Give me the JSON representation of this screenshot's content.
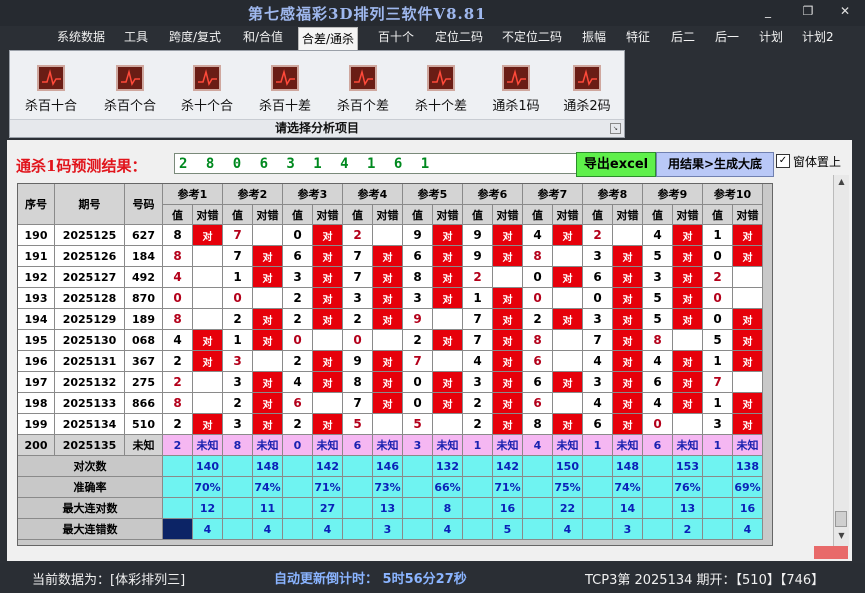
{
  "title": "第七感福彩3D排列三软件V8.81",
  "window_controls": [
    "_",
    "❐",
    "✕"
  ],
  "menu": [
    "系统数据",
    "工具",
    "跨度/复式",
    "和/合值",
    "合差/通杀",
    "百十个",
    "定位二码",
    "不定位二码",
    "振幅",
    "特征",
    "后二",
    "后一",
    "计划",
    "计划2"
  ],
  "active_menu": "合差/通杀",
  "ribbon": {
    "buttons": [
      "杀百十合",
      "杀百个合",
      "杀十个合",
      "杀百十差",
      "杀百个差",
      "杀十个差",
      "通杀1码",
      "通杀2码"
    ],
    "caption": "请选择分析项目"
  },
  "prediction": {
    "label": "通杀1码预测结果：",
    "value": "2 8 0 6 3 1 4 1 6 1"
  },
  "buttons": {
    "excel": "导出excel",
    "generate": "用结果>生成大底"
  },
  "checkbox": {
    "label": "窗体置上",
    "checked": true,
    "mark": "✓"
  },
  "table": {
    "col_seq": "序号",
    "col_issue": "期号",
    "col_code": "号码",
    "groups": [
      "参考1",
      "参考2",
      "参考3",
      "参考4",
      "参考5",
      "参考6",
      "参考7",
      "参考8",
      "参考9",
      "参考10"
    ],
    "sub": [
      "值",
      "对错"
    ],
    "hit_text": "对",
    "unknown_text": "未知",
    "rows": [
      {
        "seq": "190",
        "issue": "2025125",
        "code": "627",
        "refs": [
          [
            "8",
            1
          ],
          [
            "7",
            0
          ],
          [
            "0",
            1
          ],
          [
            "2",
            0
          ],
          [
            "9",
            1
          ],
          [
            "9",
            1
          ],
          [
            "4",
            1
          ],
          [
            "2",
            0
          ],
          [
            "4",
            1
          ],
          [
            "1",
            1
          ]
        ]
      },
      {
        "seq": "191",
        "issue": "2025126",
        "code": "184",
        "refs": [
          [
            "8",
            0
          ],
          [
            "7",
            1
          ],
          [
            "6",
            1
          ],
          [
            "7",
            1
          ],
          [
            "6",
            1
          ],
          [
            "9",
            1
          ],
          [
            "8",
            0
          ],
          [
            "3",
            1
          ],
          [
            "5",
            1
          ],
          [
            "0",
            1
          ]
        ]
      },
      {
        "seq": "192",
        "issue": "2025127",
        "code": "492",
        "refs": [
          [
            "4",
            0
          ],
          [
            "1",
            1
          ],
          [
            "3",
            1
          ],
          [
            "7",
            1
          ],
          [
            "8",
            1
          ],
          [
            "2",
            0
          ],
          [
            "0",
            1
          ],
          [
            "6",
            1
          ],
          [
            "3",
            1
          ],
          [
            "2",
            0
          ]
        ]
      },
      {
        "seq": "193",
        "issue": "2025128",
        "code": "870",
        "refs": [
          [
            "0",
            0
          ],
          [
            "0",
            0
          ],
          [
            "2",
            1
          ],
          [
            "3",
            1
          ],
          [
            "3",
            1
          ],
          [
            "1",
            1
          ],
          [
            "0",
            0
          ],
          [
            "0",
            1
          ],
          [
            "5",
            1
          ],
          [
            "0",
            0
          ]
        ]
      },
      {
        "seq": "194",
        "issue": "2025129",
        "code": "189",
        "refs": [
          [
            "8",
            0
          ],
          [
            "2",
            1
          ],
          [
            "2",
            1
          ],
          [
            "2",
            1
          ],
          [
            "9",
            0
          ],
          [
            "7",
            1
          ],
          [
            "2",
            1
          ],
          [
            "3",
            1
          ],
          [
            "5",
            1
          ],
          [
            "0",
            1
          ]
        ]
      },
      {
        "seq": "195",
        "issue": "2025130",
        "code": "068",
        "refs": [
          [
            "4",
            1
          ],
          [
            "1",
            1
          ],
          [
            "0",
            0
          ],
          [
            "0",
            0
          ],
          [
            "2",
            1
          ],
          [
            "7",
            1
          ],
          [
            "8",
            0
          ],
          [
            "7",
            1
          ],
          [
            "8",
            0
          ],
          [
            "5",
            1
          ]
        ]
      },
      {
        "seq": "196",
        "issue": "2025131",
        "code": "367",
        "refs": [
          [
            "2",
            1
          ],
          [
            "3",
            0
          ],
          [
            "2",
            1
          ],
          [
            "9",
            1
          ],
          [
            "7",
            0
          ],
          [
            "4",
            1
          ],
          [
            "6",
            0
          ],
          [
            "4",
            1
          ],
          [
            "4",
            1
          ],
          [
            "1",
            1
          ]
        ]
      },
      {
        "seq": "197",
        "issue": "2025132",
        "code": "275",
        "refs": [
          [
            "2",
            0
          ],
          [
            "3",
            1
          ],
          [
            "4",
            1
          ],
          [
            "8",
            1
          ],
          [
            "0",
            1
          ],
          [
            "3",
            1
          ],
          [
            "6",
            1
          ],
          [
            "3",
            1
          ],
          [
            "6",
            1
          ],
          [
            "7",
            0
          ]
        ]
      },
      {
        "seq": "198",
        "issue": "2025133",
        "code": "866",
        "refs": [
          [
            "8",
            0
          ],
          [
            "2",
            1
          ],
          [
            "6",
            0
          ],
          [
            "7",
            1
          ],
          [
            "0",
            1
          ],
          [
            "2",
            1
          ],
          [
            "6",
            0
          ],
          [
            "4",
            1
          ],
          [
            "4",
            1
          ],
          [
            "1",
            1
          ]
        ]
      },
      {
        "seq": "199",
        "issue": "2025134",
        "code": "510",
        "refs": [
          [
            "2",
            1
          ],
          [
            "3",
            1
          ],
          [
            "2",
            1
          ],
          [
            "5",
            0
          ],
          [
            "5",
            0
          ],
          [
            "2",
            1
          ],
          [
            "8",
            1
          ],
          [
            "6",
            1
          ],
          [
            "0",
            0
          ],
          [
            "3",
            1
          ]
        ]
      },
      {
        "seq": "200",
        "issue": "2025135",
        "code": "未知",
        "unknown": true,
        "refs": [
          [
            "2",
            0
          ],
          [
            "8",
            0
          ],
          [
            "0",
            0
          ],
          [
            "6",
            0
          ],
          [
            "3",
            0
          ],
          [
            "1",
            0
          ],
          [
            "4",
            0
          ],
          [
            "1",
            0
          ],
          [
            "6",
            0
          ],
          [
            "1",
            0
          ]
        ]
      }
    ],
    "stats": [
      {
        "label": "对次数",
        "values": [
          "140",
          "148",
          "142",
          "146",
          "132",
          "142",
          "150",
          "148",
          "153",
          "138"
        ]
      },
      {
        "label": "准确率",
        "values": [
          "70%",
          "74%",
          "71%",
          "73%",
          "66%",
          "71%",
          "75%",
          "74%",
          "76%",
          "69%"
        ]
      },
      {
        "label": "最大连对数",
        "values": [
          "12",
          "11",
          "27",
          "13",
          "8",
          "16",
          "22",
          "14",
          "13",
          "16"
        ]
      },
      {
        "label": "最大连错数",
        "values": [
          "4",
          "4",
          "4",
          "3",
          "4",
          "5",
          "4",
          "3",
          "2",
          "4"
        ]
      }
    ]
  },
  "status": {
    "current_data": "当前数据为：[体彩排列三]",
    "countdown": "自动更新倒计时： 5时56分27秒",
    "draw_info": "TCP3第 2025134 期开：【510】【746】"
  }
}
